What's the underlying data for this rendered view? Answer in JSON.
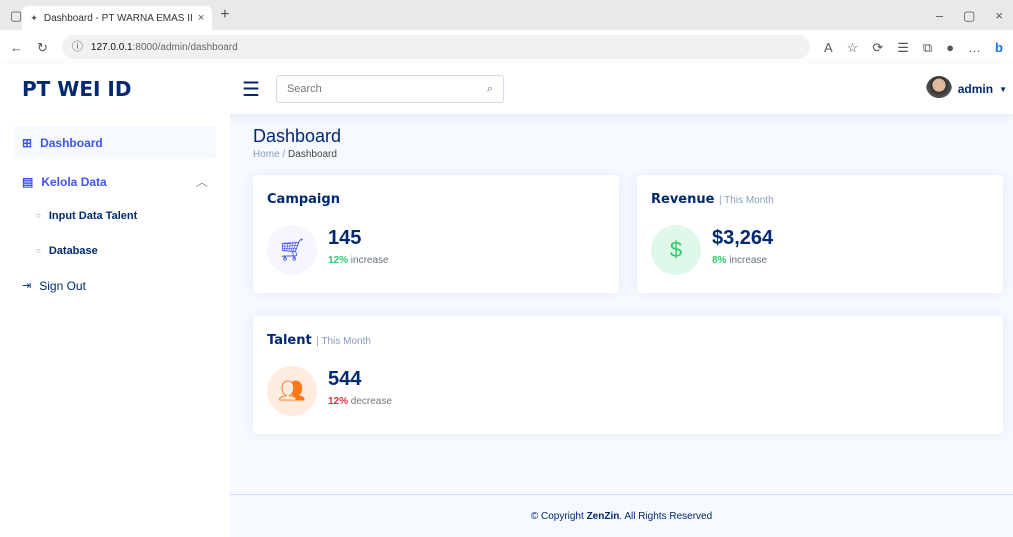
{
  "browser": {
    "tab_title": "Dashboard - PT WARNA EMAS II",
    "url_prefix": "127.0.0.1",
    "url_rest": ":8000/admin/dashboard"
  },
  "header": {
    "logo": "PT WEI ID",
    "search_placeholder": "Search",
    "user_name": "admin"
  },
  "sidebar": {
    "dashboard": "Dashboard",
    "kelola": "Kelola Data",
    "sub1": "Input Data Talent",
    "sub2": "Database",
    "signout": "Sign Out"
  },
  "page": {
    "title": "Dashboard",
    "crumb_home": "Home",
    "crumb_sep": "/",
    "crumb_current": "Dashboard"
  },
  "cards": {
    "campaign": {
      "title": "Campaign",
      "value": "145",
      "pct": "12%",
      "word": "increase"
    },
    "revenue": {
      "title": "Revenue",
      "sub": "| This Month",
      "value": "$3,264",
      "pct": "8%",
      "word": "increase"
    },
    "talent": {
      "title": "Talent",
      "sub": "| This Month",
      "value": "544",
      "pct": "12%",
      "word": "decrease"
    }
  },
  "footer": {
    "pre": "© Copyright",
    "brand": "ZenZin",
    "post": ". All Rights Reserved"
  },
  "colors": {
    "primary": "#012970",
    "accent": "#4154f1",
    "green": "#2eca6a",
    "red": "#dc3545",
    "orange": "#ff771d"
  }
}
